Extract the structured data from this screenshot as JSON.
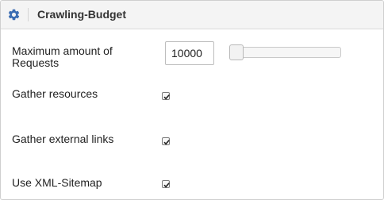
{
  "panel": {
    "title": "Crawling-Budget",
    "header_icon": "gear-icon",
    "accent_color": "#3b6db3"
  },
  "settings": {
    "max_requests": {
      "label_line1": "Maximum amount of",
      "label_line2": "Requests",
      "value": "10000",
      "slider_fraction": 0.0
    },
    "gather_resources": {
      "label": "Gather resources",
      "checked": true
    },
    "gather_external_links": {
      "label": "Gather external links",
      "checked": true
    },
    "use_xml_sitemap": {
      "label": "Use XML-Sitemap",
      "checked": true
    }
  }
}
